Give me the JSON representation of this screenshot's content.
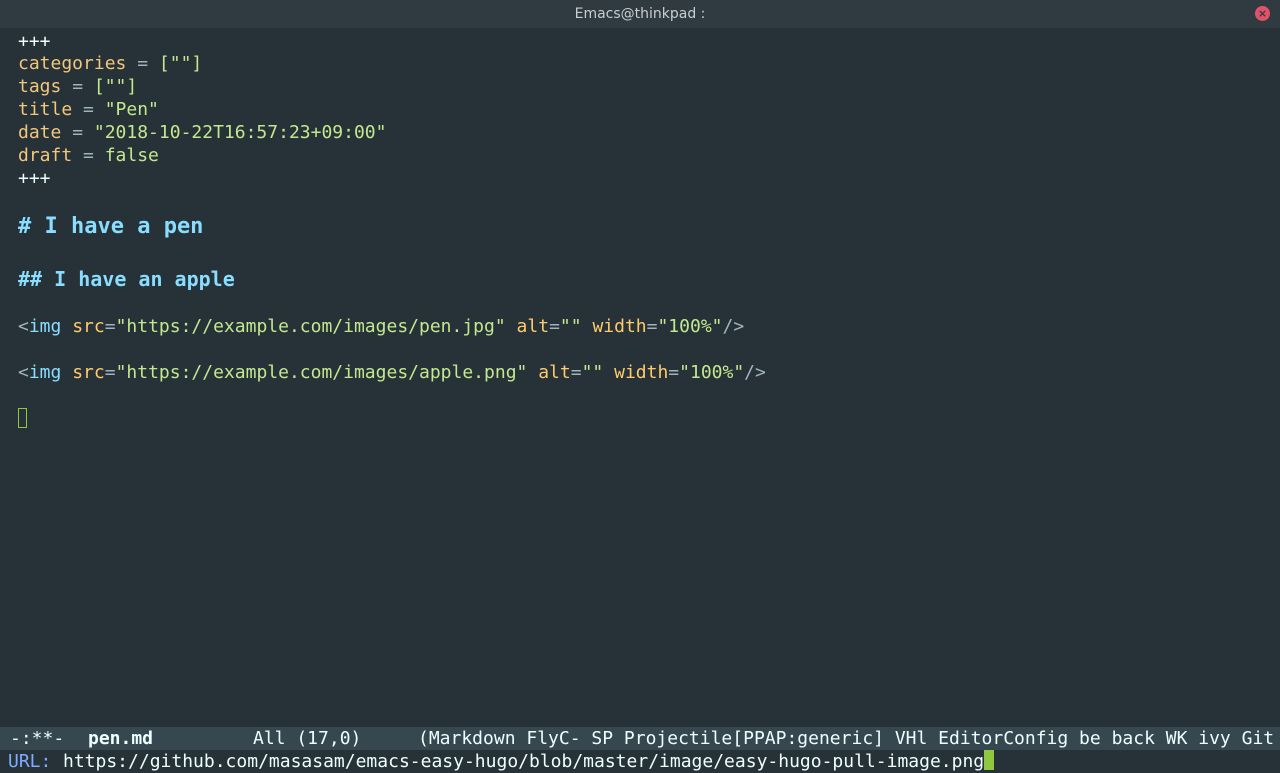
{
  "window": {
    "title": "Emacs@thinkpad :",
    "close_glyph": "×"
  },
  "buffer": {
    "front_matter_open": "+++",
    "categories_key": "categories",
    "categories_value": "[\"\"]",
    "tags_key": "tags",
    "tags_value": "[\"\"]",
    "title_key": "title",
    "title_value": "\"Pen\"",
    "date_key": "date",
    "date_value": "\"2018-10-22T16:57:23+09:00\"",
    "draft_key": "draft",
    "draft_value": "false",
    "front_matter_close": "+++",
    "equals": " = ",
    "heading1": "# I have a pen",
    "heading2": "## I have an apple",
    "img1": {
      "open": "<",
      "tag": "img",
      "src_attr": "src",
      "src_value": "\"https://example.com/images/pen.jpg\"",
      "alt_attr": "alt",
      "alt_value": "\"\"",
      "width_attr": "width",
      "width_value": "\"100%\"",
      "close": "/>"
    },
    "img2": {
      "open": "<",
      "tag": "img",
      "src_attr": "src",
      "src_value": "\"https://example.com/images/apple.png\"",
      "alt_attr": "alt",
      "alt_value": "\"\"",
      "width_attr": "width",
      "width_value": "\"100%\"",
      "close": "/>"
    }
  },
  "modeline": {
    "status": "-:**-",
    "buffer_name": "pen.md",
    "position": "All (17,0)",
    "modes": "(Markdown FlyC- SP Projectile[PPAP:generic] VHl EditorConfig be back WK ivy Git"
  },
  "minibuffer": {
    "prompt": "URL:",
    "input": "https://github.com/masasam/emacs-easy-hugo/blob/master/image/easy-hugo-pull-image.png"
  },
  "colors": {
    "background": "#263238",
    "modeline_bg": "#37474f",
    "heading": "#89ddff",
    "key": "#f2c77c",
    "string": "#c3e88d",
    "cursor": "#8fc73e"
  }
}
